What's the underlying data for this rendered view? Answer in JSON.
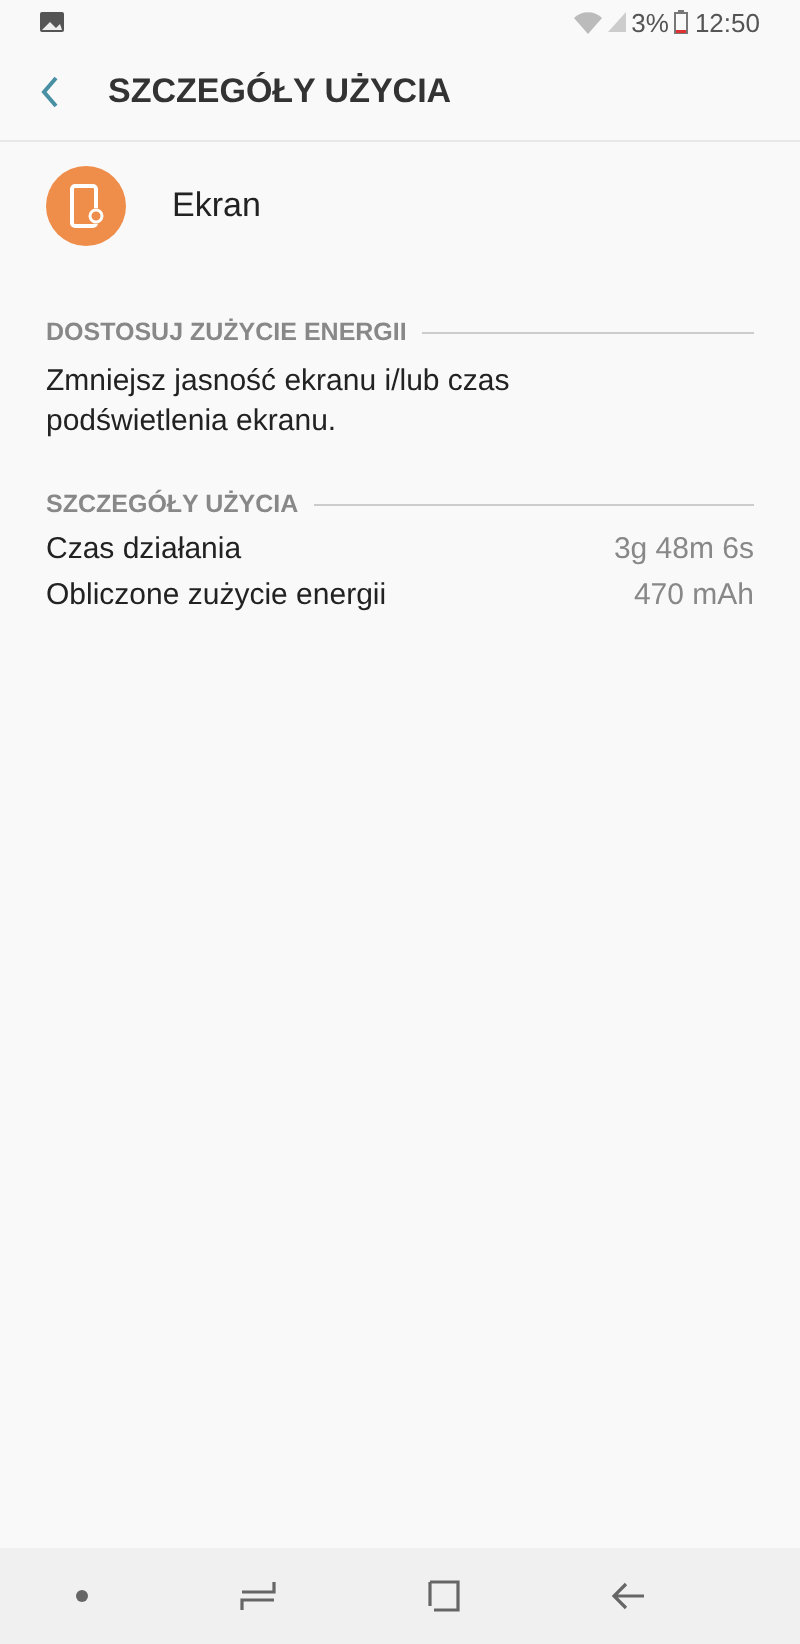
{
  "status_bar": {
    "battery": "3%",
    "time": "12:50"
  },
  "header": {
    "title": "SZCZEGÓŁY UŻYCIA"
  },
  "app": {
    "name": "Ekran"
  },
  "sections": [
    {
      "title": "DOSTOSUJ ZUŻYCIE ENERGII",
      "kind": "text",
      "text": "Zmniejsz jasność ekranu i/lub czas podświetlenia ekranu."
    },
    {
      "title": "SZCZEGÓŁY UŻYCIA",
      "kind": "rows",
      "rows": [
        {
          "label": "Czas działania",
          "value": "3g 48m 6s"
        },
        {
          "label": "Obliczone zużycie energii",
          "value": "470 mAh"
        }
      ]
    }
  ]
}
